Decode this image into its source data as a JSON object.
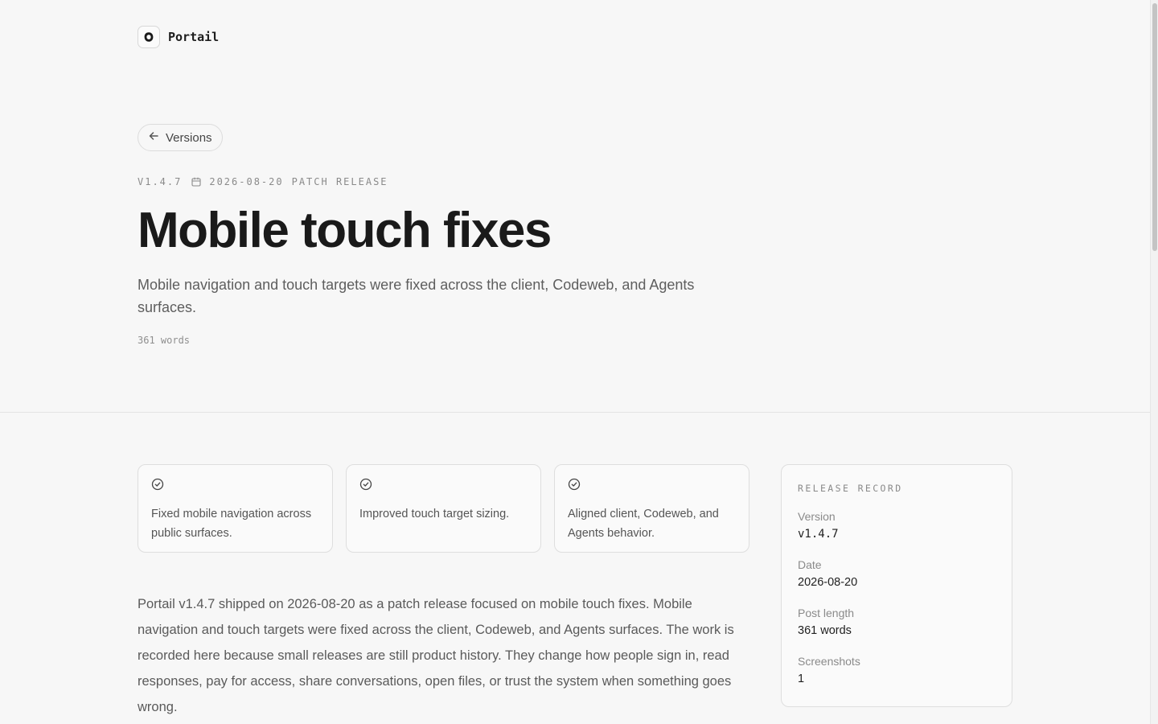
{
  "brand": {
    "name": "Portail"
  },
  "nav": {
    "back_label": "Versions"
  },
  "release": {
    "version_tag": "V1.4.7",
    "date": "2026-08-20",
    "type": "PATCH RELEASE",
    "title": "Mobile touch fixes",
    "summary": "Mobile navigation and touch targets were fixed across the client, Codeweb, and Agents surfaces.",
    "word_count": "361 words"
  },
  "highlights": [
    {
      "text": "Fixed mobile navigation across public surfaces."
    },
    {
      "text": "Improved touch target sizing."
    },
    {
      "text": "Aligned client, Codeweb, and Agents behavior."
    }
  ],
  "body": {
    "paragraph": "Portail v1.4.7 shipped on 2026-08-20 as a patch release focused on mobile touch fixes. Mobile navigation and touch targets were fixed across the client, Codeweb, and Agents surfaces. The work is recorded here because small releases are still product history. They change how people sign in, read responses, pay for access, share conversations, open files, or trust the system when something goes wrong."
  },
  "record": {
    "heading": "RELEASE RECORD",
    "items": [
      {
        "label": "Version",
        "value": "v1.4.7"
      },
      {
        "label": "Date",
        "value": "2026-08-20"
      },
      {
        "label": "Post length",
        "value": "361 words"
      },
      {
        "label": "Screenshots",
        "value": "1"
      }
    ]
  },
  "icons": {
    "brand": "portail-logo-icon",
    "back": "arrow-left-icon",
    "date": "calendar-icon",
    "highlight": "check-circle-icon"
  }
}
